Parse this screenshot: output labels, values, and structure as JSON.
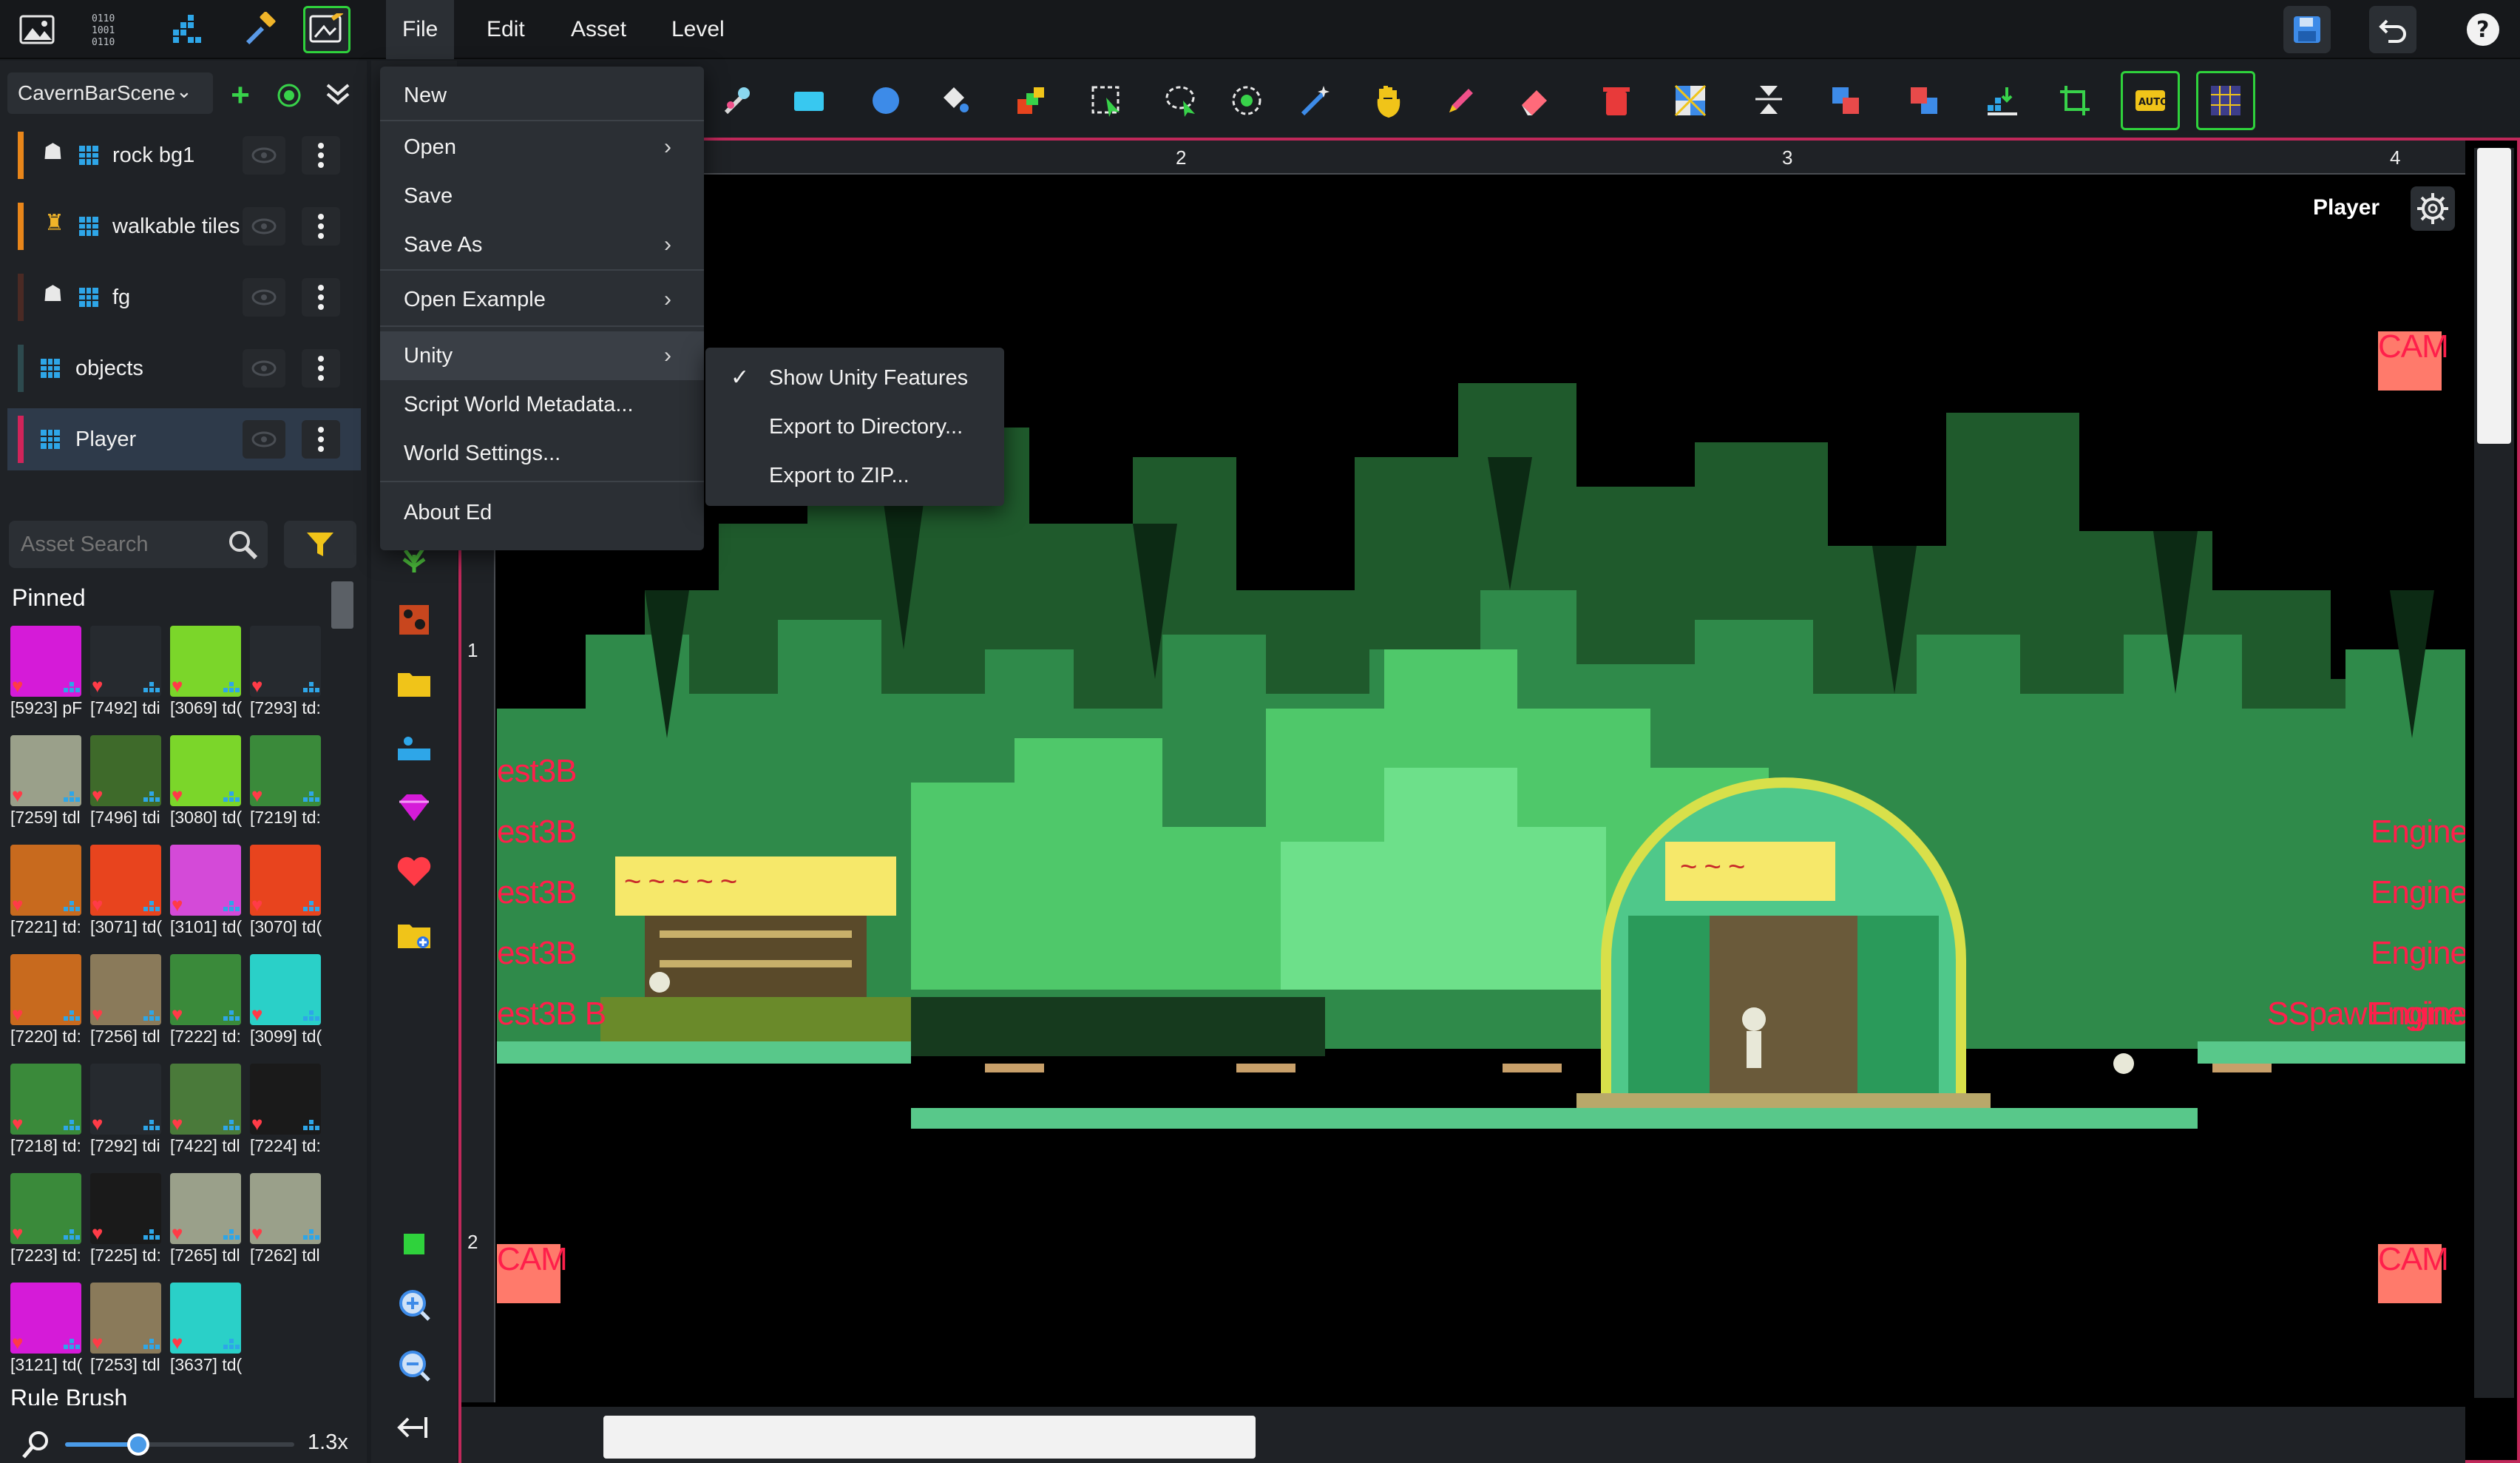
{
  "menubar": {
    "file": "File",
    "edit": "Edit",
    "asset": "Asset",
    "level": "Level"
  },
  "scene": {
    "name": "CavernBarScene"
  },
  "layers": [
    {
      "name": "rock bg1",
      "color": "#e8861a"
    },
    {
      "name": "walkable tiles",
      "color": "#e8861a"
    },
    {
      "name": "fg",
      "color": "#4a2a24"
    },
    {
      "name": "objects",
      "color": "#2d4a4e"
    },
    {
      "name": "Player",
      "color": "#d0245a"
    }
  ],
  "search": {
    "placeholder": "Asset Search"
  },
  "pinned": {
    "title": "Pinned"
  },
  "assets": [
    {
      "label": "[5923] pF",
      "color": "#d51bd8"
    },
    {
      "label": "[7492] tdi",
      "color": "#262a2f"
    },
    {
      "label": "[3069] td(",
      "color": "#7bd62a"
    },
    {
      "label": "[7293] td:",
      "color": "#262a2f"
    },
    {
      "label": "[7259] tdl",
      "color": "#9aa08a"
    },
    {
      "label": "[7496] tdi",
      "color": "#3e6a2a"
    },
    {
      "label": "[3080] td(",
      "color": "#7bd62a"
    },
    {
      "label": "[7219] td:",
      "color": "#3a8a3a"
    },
    {
      "label": "[7221] td:",
      "color": "#c86a1e"
    },
    {
      "label": "[3071] td(",
      "color": "#e8441e"
    },
    {
      "label": "[3101] td(",
      "color": "#d44ad8"
    },
    {
      "label": "[3070] td(",
      "color": "#e8441e"
    },
    {
      "label": "[7220] td:",
      "color": "#c86a1e"
    },
    {
      "label": "[7256] tdl",
      "color": "#8a7a5a"
    },
    {
      "label": "[7222] td:",
      "color": "#3a8a3a"
    },
    {
      "label": "[3099] td(",
      "color": "#2ad0c8"
    },
    {
      "label": "[7218] td:",
      "color": "#3a8a3a"
    },
    {
      "label": "[7292] tdi",
      "color": "#262a2f"
    },
    {
      "label": "[7422] tdl",
      "color": "#4a7a3a"
    },
    {
      "label": "[7224] td:",
      "color": "#1a1a1a"
    },
    {
      "label": "[7223] td:",
      "color": "#3a8a3a"
    },
    {
      "label": "[7225] td:",
      "color": "#1a1a1a"
    },
    {
      "label": "[7265] tdl",
      "color": "#9aa08a"
    },
    {
      "label": "[7262] tdl",
      "color": "#9aa08a"
    },
    {
      "label": "[3121] td(",
      "color": "#d51bd8"
    },
    {
      "label": "[7253] tdl",
      "color": "#8a7a5a"
    },
    {
      "label": "[3637] td(",
      "color": "#2ad0c8"
    }
  ],
  "rule_brush": "Rule Brush",
  "zoom": {
    "value": "1.3x",
    "fraction": 0.32
  },
  "file_menu": {
    "items": [
      "New",
      "Open",
      "Save",
      "Save As",
      "Open Example",
      "Unity",
      "Script World Metadata...",
      "World Settings...",
      "About Ed"
    ]
  },
  "unity_menu": {
    "items": [
      "Show Unity Features",
      "Export to Directory...",
      "Export to ZIP..."
    ],
    "checked": "Show Unity Features"
  },
  "ruler": {
    "top": [
      "2",
      "3",
      "4"
    ],
    "left": [
      "1",
      "2"
    ]
  },
  "canvas": {
    "player_label": "Player",
    "cam": "CAM",
    "left_labels": [
      "est3B",
      "est3B",
      "est3B",
      "est3B",
      "est3B B"
    ],
    "right_labels": [
      "Engine",
      "Engine",
      "Engine",
      "Engine"
    ],
    "spawn_label": "SSpawEngine",
    "sign": "~ ~ ~ ~ ~",
    "sign2": "~ ~ ~"
  },
  "colors": {
    "accent": "#2fd23c",
    "border": "#c0285a",
    "overlay_text": "#ff1f4b"
  }
}
